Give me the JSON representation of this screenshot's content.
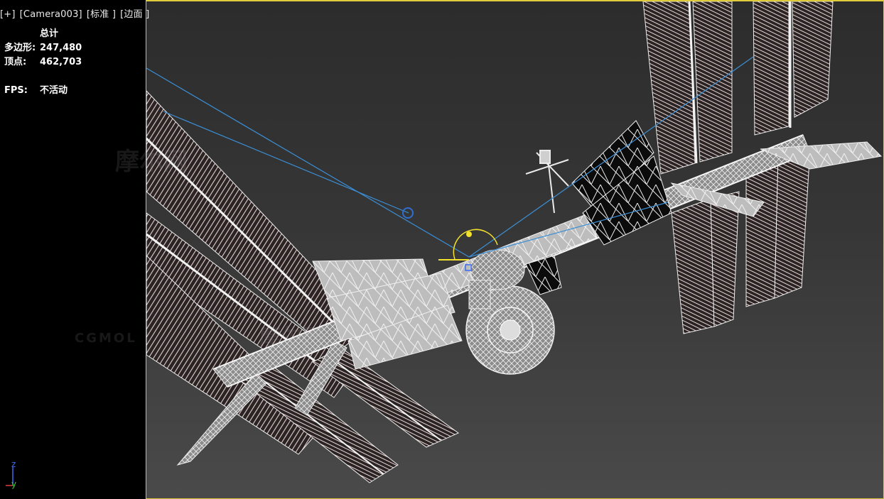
{
  "viewport": {
    "labels": [
      "[+]",
      "[Camera003]",
      "[标准 ]",
      "[边面 ]"
    ]
  },
  "stats": {
    "header": "总计",
    "polys_label": "多边形:",
    "polys_value": "247,480",
    "verts_label": "顶点:",
    "verts_value": "462,703",
    "fps_label": "FPS:",
    "fps_value": "不活动"
  },
  "watermarks": {
    "text1": "摩尔网",
    "text2": "CGMOL",
    "text3": "摩尔网"
  },
  "axis": {
    "z": "z",
    "y": "y"
  },
  "colors": {
    "viewport_border": "#e0cb3a",
    "wire": "#e6e6e6",
    "panel_wire": "#e0c8c8",
    "camera_line": "#3b8fd6",
    "gizmo": "#f2e22a",
    "axis_z": "#3a6cf0",
    "axis_y": "#3ad23a"
  }
}
